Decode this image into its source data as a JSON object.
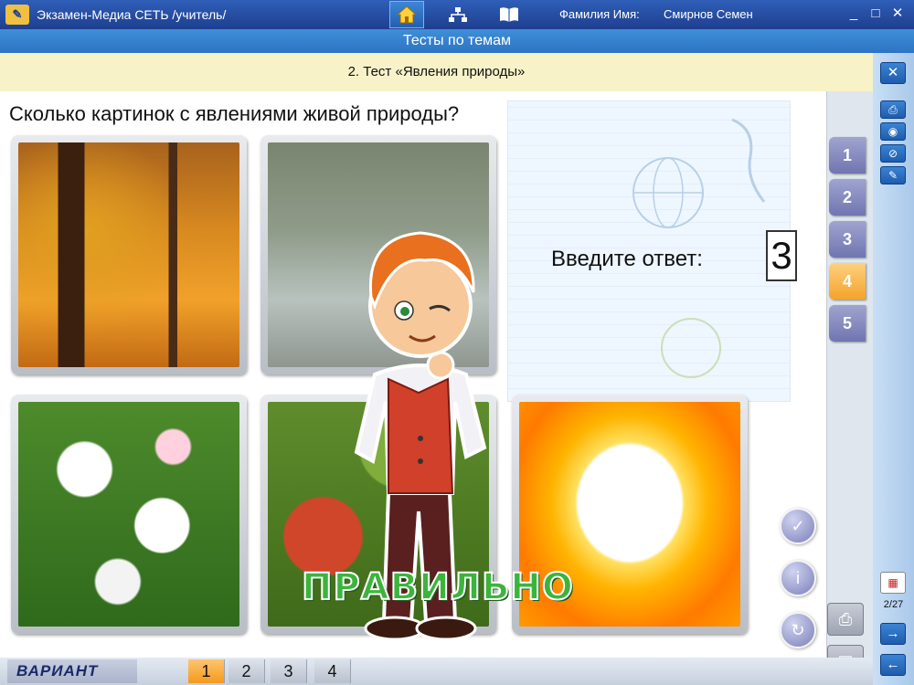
{
  "titlebar": {
    "app_title": "Экзамен-Медиа СЕТЬ /учитель/",
    "user_label": "Фамилия Имя:",
    "user_name": "Смирнов Семен"
  },
  "section": {
    "title": "Тесты по темам"
  },
  "test": {
    "title": "2. Тест «Явления природы»"
  },
  "question": {
    "text": "Сколько картинок с явлениями живой природы?",
    "answer_label": "Введите ответ:",
    "answer_value": "3"
  },
  "result": {
    "label": "ПРАВИЛЬНО"
  },
  "question_tabs": [
    "1",
    "2",
    "3",
    "4",
    "5"
  ],
  "active_question_tab": "4",
  "footer": {
    "variant_label": "ВАРИАНТ",
    "variants": [
      "1",
      "2",
      "3",
      "4"
    ],
    "active_variant": "1"
  },
  "sidebar": {
    "page_counter": "2/27"
  },
  "colors": {
    "titlebar": "#1e3f8f",
    "section_bar": "#2c74c4",
    "test_bar": "#f7f2c8",
    "active_tab": "#f3a32a",
    "tab": "#7075b0",
    "correct_text": "#3cb43c"
  }
}
